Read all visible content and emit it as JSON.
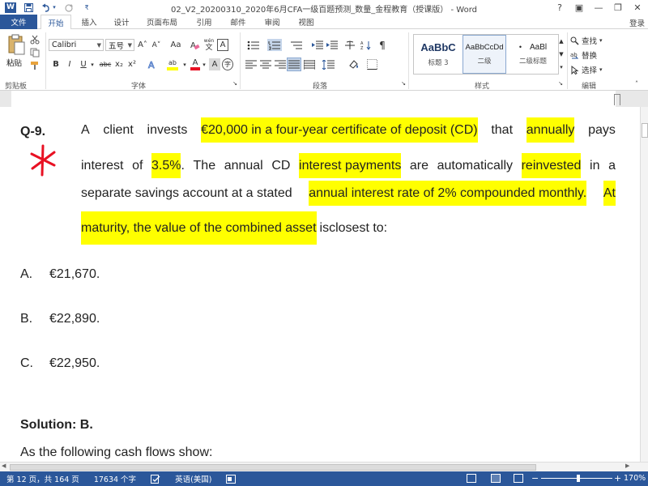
{
  "window": {
    "title": "02_V2_20200310_2020年6月CFA一级百题预测_数量_金程教育（授课版） - Word",
    "word_logo": "W",
    "controls": [
      "?",
      "▣",
      "—",
      "❐",
      "✕"
    ]
  },
  "tabs": {
    "file": "文件",
    "items": [
      "开始",
      "插入",
      "设计",
      "页面布局",
      "引用",
      "邮件",
      "审阅",
      "视图"
    ],
    "active": "开始",
    "login": "登录"
  },
  "ribbon": {
    "clipboard": {
      "paste": "粘贴",
      "label": "剪贴板"
    },
    "font": {
      "font_name": "Calibri",
      "font_size": "五号",
      "label": "字体",
      "buttons": [
        "B",
        "I",
        "U",
        "abc",
        "x₂",
        "x²"
      ],
      "grow": "A˄",
      "shrink": "A˅",
      "case": "Aa",
      "phonetic_top": "wén",
      "phonetic_bottom": "文",
      "border_a": "A",
      "highlight_text": "ab",
      "color_text": "A",
      "char_shade": "A",
      "circle_char": "字"
    },
    "paragraph": {
      "label": "段落"
    },
    "styles": {
      "label": "样式",
      "items": [
        {
          "sample": "AaBbC",
          "name": "标题 3"
        },
        {
          "sample": "AaBbCcDd",
          "name": "二级"
        },
        {
          "sample": "AaBl",
          "name": "二级标题"
        }
      ]
    },
    "editing": {
      "label": "编辑",
      "find": "查找",
      "replace": "替换",
      "select": "选择"
    },
    "colors": {
      "highlight": "#ffff00",
      "font_color": "#e81123"
    }
  },
  "document": {
    "question_number": "Q-9.",
    "lines": [
      [
        {
          "t": "A",
          "hl": false
        },
        {
          "t": "client",
          "hl": false
        },
        {
          "t": "invests",
          "hl": false
        },
        {
          "t": "€20,000 in a four-year certificate of deposit (CD)",
          "hl": true
        },
        {
          "t": "that",
          "hl": false
        },
        {
          "t": "annually",
          "hl": true
        },
        {
          "t": "pays",
          "hl": false
        }
      ],
      [
        {
          "t": "interest",
          "hl": false
        },
        {
          "t": "of",
          "hl": false
        },
        {
          "t": "3.5%",
          "hl": true
        },
        {
          "t": ".",
          "hl": false,
          "attach": true
        },
        {
          "t": "The",
          "hl": false
        },
        {
          "t": "annual",
          "hl": false
        },
        {
          "t": "CD",
          "hl": false
        },
        {
          "t": "interest payments",
          "hl": true
        },
        {
          "t": "are",
          "hl": false
        },
        {
          "t": "automatically",
          "hl": false
        },
        {
          "t": "reinvested",
          "hl": true
        },
        {
          "t": "in",
          "hl": false
        },
        {
          "t": "a",
          "hl": false
        }
      ],
      [
        {
          "t": "separate savings account at a stated",
          "hl": false
        },
        {
          "t": "annual interest rate of 2% compounded monthly.",
          "hl": true
        },
        {
          "t": "At",
          "hl": true
        }
      ],
      [
        {
          "t": "maturity, the value of the combined asset",
          "hl": true
        },
        {
          "t": "isclosest to:",
          "hl": false
        }
      ]
    ],
    "options": [
      {
        "letter": "A.",
        "text": "€21,670."
      },
      {
        "letter": "B.",
        "text": "€22,890."
      },
      {
        "letter": "C.",
        "text": "€22,950."
      }
    ],
    "solution": "Solution: B.",
    "cash_flows": "As the following cash flows show:",
    "annotation_color": "#e81123"
  },
  "status": {
    "page": "第 12 页，共 164 页",
    "words": "17634 个字",
    "language": "英语(美国)",
    "zoom": "170%",
    "zoom_minus": "−",
    "zoom_plus": "+"
  }
}
